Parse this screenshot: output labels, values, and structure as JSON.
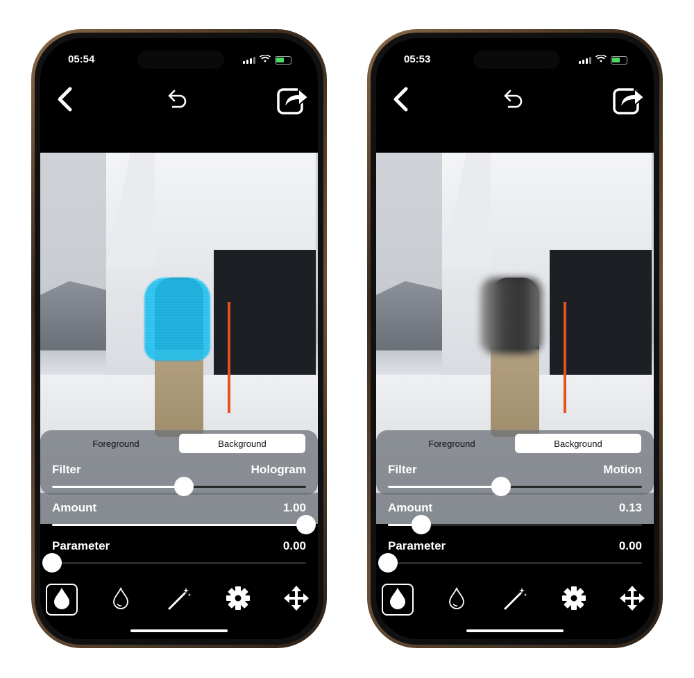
{
  "phones": [
    {
      "status": {
        "time": "05:54"
      },
      "segments": [
        "Foreground",
        "Background"
      ],
      "active_segment": 1,
      "filter": {
        "label": "Filter",
        "value": "Hologram",
        "slider": 0.52
      },
      "amount": {
        "label": "Amount",
        "value": "1.00",
        "slider": 1.0
      },
      "parameter": {
        "label": "Parameter",
        "value": "0.00",
        "slider": 0.0
      },
      "effect": "hologram"
    },
    {
      "status": {
        "time": "05:53"
      },
      "segments": [
        "Foreground",
        "Background"
      ],
      "active_segment": 1,
      "filter": {
        "label": "Filter",
        "value": "Motion",
        "slider": 0.445
      },
      "amount": {
        "label": "Amount",
        "value": "0.13",
        "slider": 0.13
      },
      "parameter": {
        "label": "Parameter",
        "value": "0.00",
        "slider": 0.0
      },
      "effect": "motion-blur"
    }
  ],
  "toolbar_icons": [
    "drop-filled-icon",
    "drop-outline-icon",
    "magic-wand-icon",
    "gear-icon",
    "move-arrows-icon"
  ],
  "selected_tool": 0,
  "colors": {
    "hologram": "#2fd8ff",
    "battery": "#4cd964",
    "frame": "#6b5038"
  }
}
